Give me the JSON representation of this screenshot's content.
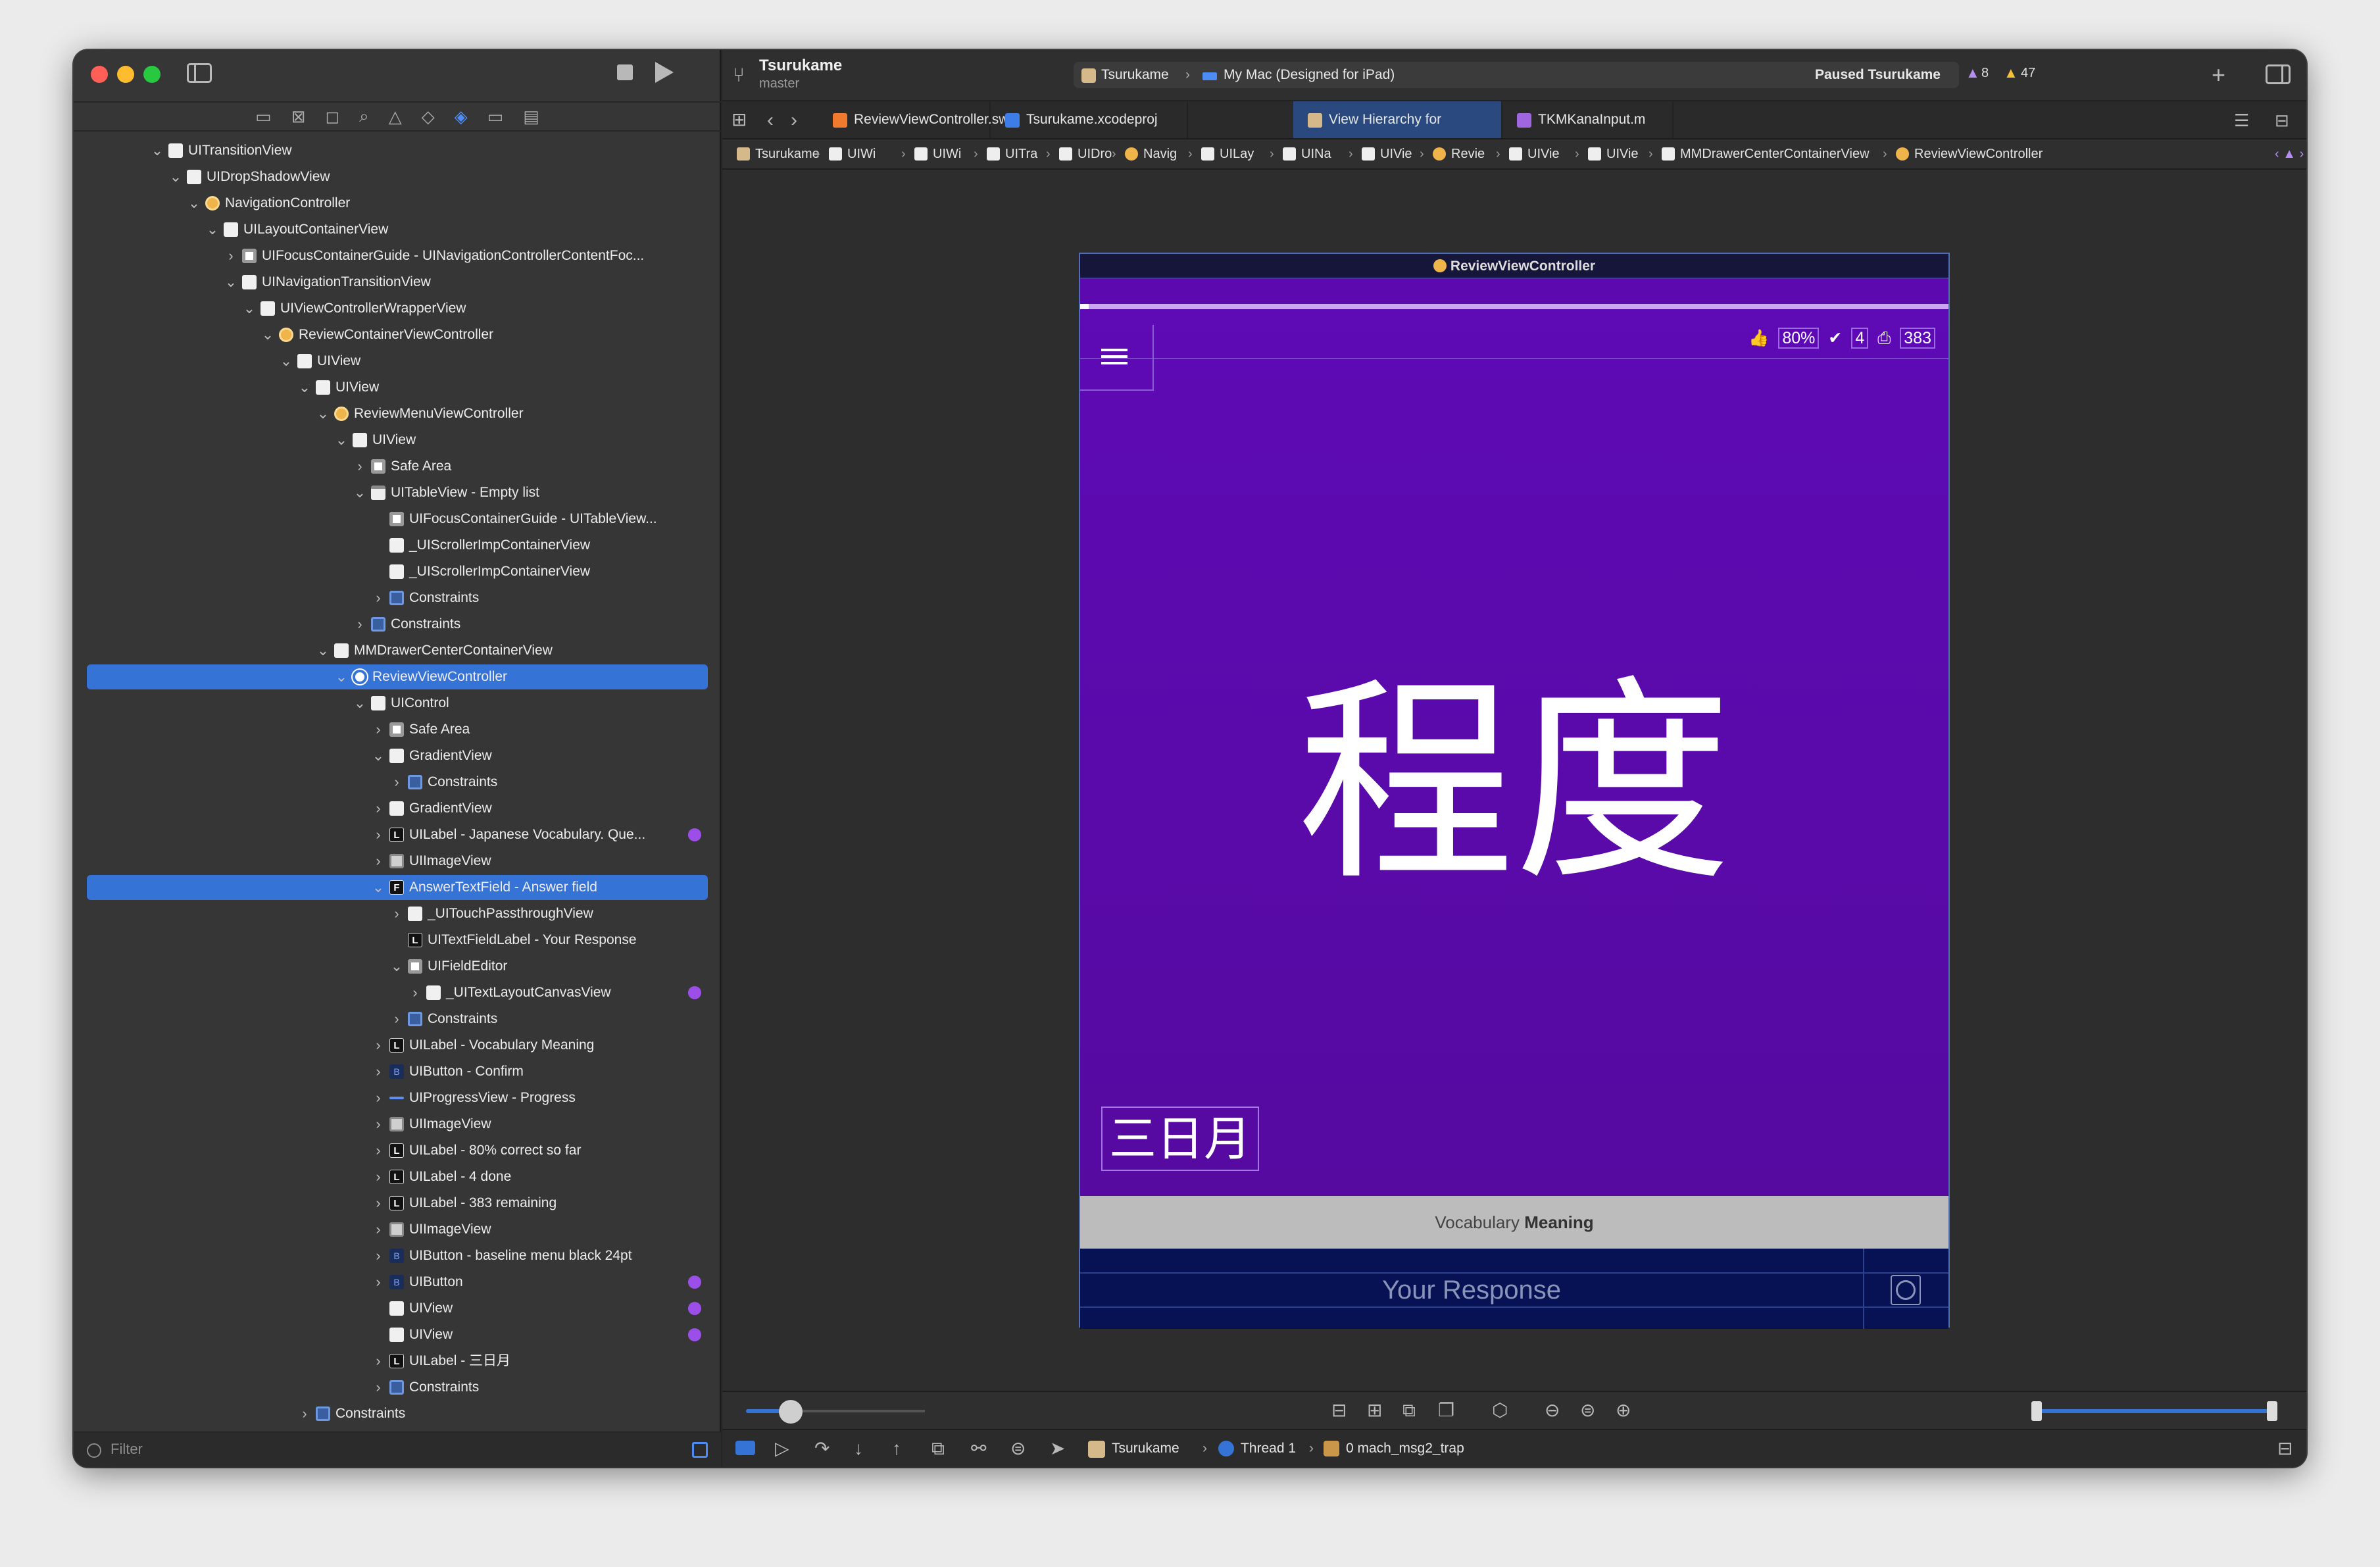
{
  "window": {
    "project": "Tsurukame",
    "branch": "master",
    "scheme": "Tsurukame",
    "destination": "My Mac (Designed for iPad)",
    "status": "Paused Tsurukame",
    "errors": "8",
    "warnings": "47"
  },
  "navigator": {
    "filter_placeholder": "Filter",
    "rows": [
      {
        "label": "UITransitionView",
        "indent": 0,
        "twist": "v",
        "icon": "view"
      },
      {
        "label": "UIDropShadowView",
        "indent": 1,
        "twist": "v",
        "icon": "view"
      },
      {
        "label": "NavigationController",
        "indent": 2,
        "twist": "v",
        "icon": "ctrl"
      },
      {
        "label": "UILayoutContainerView",
        "indent": 3,
        "twist": "v",
        "icon": "view"
      },
      {
        "label": "UIFocusContainerGuide - UINavigationControllerContentFoc...",
        "indent": 4,
        "twist": ">",
        "icon": "safe"
      },
      {
        "label": "UINavigationTransitionView",
        "indent": 4,
        "twist": "v",
        "icon": "view"
      },
      {
        "label": "UIViewControllerWrapperView",
        "indent": 5,
        "twist": "v",
        "icon": "view"
      },
      {
        "label": "ReviewContainerViewController",
        "indent": 6,
        "twist": "v",
        "icon": "ctrl"
      },
      {
        "label": "UIView",
        "indent": 7,
        "twist": "v",
        "icon": "view"
      },
      {
        "label": "UIView",
        "indent": 8,
        "twist": "v",
        "icon": "view"
      },
      {
        "label": "ReviewMenuViewController",
        "indent": 9,
        "twist": "v",
        "icon": "ctrl"
      },
      {
        "label": "UIView",
        "indent": 10,
        "twist": "v",
        "icon": "view"
      },
      {
        "label": "Safe Area",
        "indent": 11,
        "twist": ">",
        "icon": "safe"
      },
      {
        "label": "UITableView - Empty list",
        "indent": 11,
        "twist": "v",
        "icon": "tbl"
      },
      {
        "label": "UIFocusContainerGuide - UITableView...",
        "indent": 12,
        "twist": "",
        "icon": "safe"
      },
      {
        "label": "_UIScrollerImpContainerView",
        "indent": 12,
        "twist": "",
        "icon": "view"
      },
      {
        "label": "_UIScrollerImpContainerView",
        "indent": 12,
        "twist": "",
        "icon": "view"
      },
      {
        "label": "Constraints",
        "indent": 12,
        "twist": ">",
        "icon": "cons"
      },
      {
        "label": "Constraints",
        "indent": 11,
        "twist": ">",
        "icon": "cons"
      },
      {
        "label": "MMDrawerCenterContainerView",
        "indent": 9,
        "twist": "v",
        "icon": "view"
      },
      {
        "label": "ReviewViewController",
        "indent": 10,
        "twist": "v",
        "icon": "ctrlw",
        "selected": true
      },
      {
        "label": "UIControl",
        "indent": 11,
        "twist": "v",
        "icon": "view"
      },
      {
        "label": "Safe Area",
        "indent": 12,
        "twist": ">",
        "icon": "safe"
      },
      {
        "label": "GradientView",
        "indent": 12,
        "twist": "v",
        "icon": "view"
      },
      {
        "label": "Constraints",
        "indent": 13,
        "twist": ">",
        "icon": "cons"
      },
      {
        "label": "GradientView",
        "indent": 12,
        "twist": ">",
        "icon": "view"
      },
      {
        "label": "UILabel - Japanese Vocabulary. Que...",
        "indent": 12,
        "twist": ">",
        "icon": "lab",
        "iconText": "L",
        "badge": true
      },
      {
        "label": "UIImageView",
        "indent": 12,
        "twist": ">",
        "icon": "img"
      },
      {
        "label": "AnswerTextField - Answer field",
        "indent": 12,
        "twist": "v",
        "icon": "lab",
        "iconText": "F",
        "selected": true
      },
      {
        "label": "_UITouchPassthroughView",
        "indent": 13,
        "twist": ">",
        "icon": "view"
      },
      {
        "label": "UITextFieldLabel - Your Response",
        "indent": 13,
        "twist": "",
        "icon": "lab",
        "iconText": "L"
      },
      {
        "label": "UIFieldEditor",
        "indent": 13,
        "twist": "v",
        "icon": "safe"
      },
      {
        "label": "_UITextLayoutCanvasView",
        "indent": 14,
        "twist": ">",
        "icon": "view",
        "badge": true
      },
      {
        "label": "Constraints",
        "indent": 13,
        "twist": ">",
        "icon": "cons"
      },
      {
        "label": "UILabel - Vocabulary Meaning",
        "indent": 12,
        "twist": ">",
        "icon": "lab",
        "iconText": "L"
      },
      {
        "label": "UIButton - Confirm",
        "indent": 12,
        "twist": ">",
        "icon": "btn",
        "iconText": "B"
      },
      {
        "label": "UIProgressView - Progress",
        "indent": 12,
        "twist": ">",
        "icon": "prog"
      },
      {
        "label": "UIImageView",
        "indent": 12,
        "twist": ">",
        "icon": "img"
      },
      {
        "label": "UILabel - 80% correct so far",
        "indent": 12,
        "twist": ">",
        "icon": "lab",
        "iconText": "L"
      },
      {
        "label": "UILabel - 4 done",
        "indent": 12,
        "twist": ">",
        "icon": "lab",
        "iconText": "L"
      },
      {
        "label": "UILabel - 383 remaining",
        "indent": 12,
        "twist": ">",
        "icon": "lab",
        "iconText": "L"
      },
      {
        "label": "UIImageView",
        "indent": 12,
        "twist": ">",
        "icon": "img"
      },
      {
        "label": "UIButton - baseline menu black 24pt",
        "indent": 12,
        "twist": ">",
        "icon": "btn",
        "iconText": "B"
      },
      {
        "label": "UIButton",
        "indent": 12,
        "twist": ">",
        "icon": "btn",
        "iconText": "B",
        "badge": true
      },
      {
        "label": "UIView",
        "indent": 12,
        "twist": "",
        "icon": "view",
        "badge": true
      },
      {
        "label": "UIView",
        "indent": 12,
        "twist": "",
        "icon": "view",
        "badge": true
      },
      {
        "label": "UILabel - 三日月",
        "indent": 12,
        "twist": ">",
        "icon": "lab",
        "iconText": "L"
      },
      {
        "label": "Constraints",
        "indent": 12,
        "twist": ">",
        "icon": "cons"
      },
      {
        "label": "Constraints",
        "indent": 8,
        "twist": ">",
        "icon": "cons"
      }
    ]
  },
  "tabs": [
    {
      "label": "ReviewViewController.swift",
      "icon_color": "#f07a2e"
    },
    {
      "label": "Tsurukame.xcodeproj",
      "icon_color": "#3d7de8"
    },
    {
      "label": "View Hierarchy for Tsurukame",
      "icon_color": "#d6b98a",
      "active": true
    },
    {
      "label": "TKMKanaInput.m",
      "icon_color": "#a066e0"
    }
  ],
  "jumpbar": [
    "Tsurukame",
    "UIWi",
    "UIWi",
    "UITra",
    "UIDro",
    "Navig",
    "UILay",
    "UINa",
    "UIVie",
    "Revie",
    "UIVie",
    "UIVie",
    "MMDrawerCenterContainerView",
    "ReviewViewController"
  ],
  "simulator": {
    "caption": "ReviewViewController",
    "percent": "80%",
    "done": "4",
    "remaining": "383",
    "kanji": "程度",
    "reading": "三日月",
    "meaning_prefix": "Vocabulary ",
    "meaning_bold": "Meaning",
    "response_placeholder": "Your Response",
    "progress": 0.01
  },
  "debugbar": {
    "scheme": "Tsurukame",
    "thread": "Thread 1",
    "frame": "0 mach_msg2_trap"
  },
  "colors": {
    "accent": "#3673d6",
    "purple": "#5a0aa8",
    "navy": "#061254"
  }
}
